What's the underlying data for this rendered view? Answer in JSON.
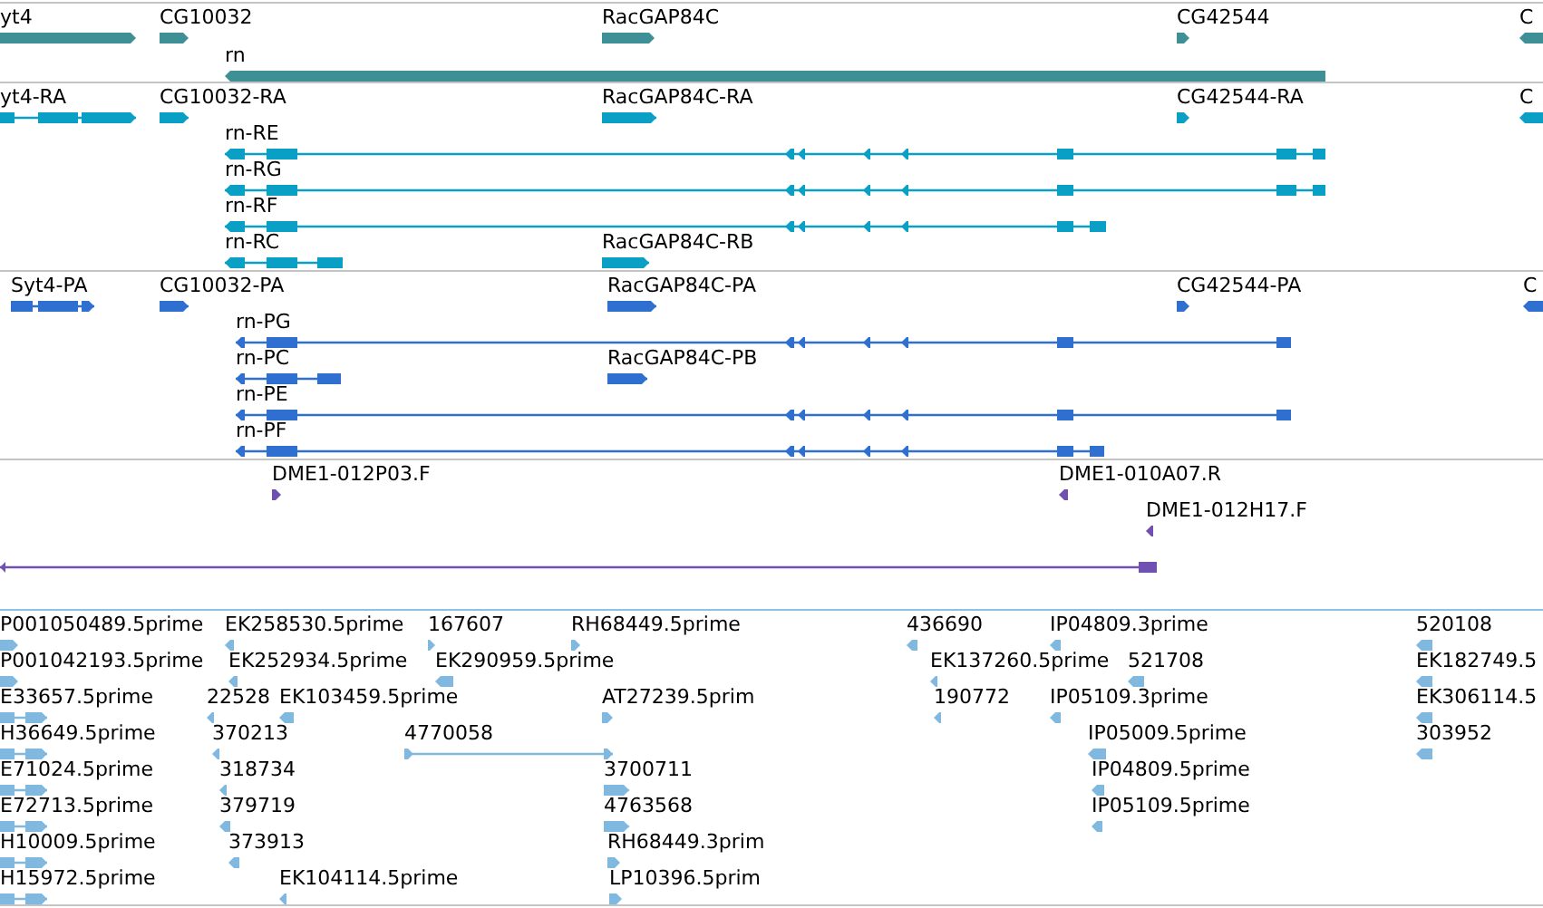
{
  "tracks": [
    {
      "color": "#3f9096",
      "features": [
        {
          "label": "yt4",
          "reverse": false
        },
        {
          "label": "CG10032",
          "reverse": false
        },
        {
          "label": "RacGAP84C",
          "reverse": false
        },
        {
          "label": "CG42544",
          "reverse": false
        },
        {
          "label": "C",
          "reverse": true
        },
        {
          "label": "rn",
          "reverse": true
        }
      ]
    },
    {
      "color": "#0a9fc4",
      "features": [
        {
          "label": "yt4-RA",
          "reverse": false
        },
        {
          "label": "CG10032-RA",
          "reverse": false
        },
        {
          "label": "RacGAP84C-RA",
          "reverse": false
        },
        {
          "label": "CG42544-RA",
          "reverse": false
        },
        {
          "label": "C",
          "reverse": true
        },
        {
          "label": "rn-RE",
          "reverse": true
        },
        {
          "label": "rn-RG",
          "reverse": true
        },
        {
          "label": "rn-RF",
          "reverse": true
        },
        {
          "label": "rn-RC",
          "reverse": true
        },
        {
          "label": "RacGAP84C-RB",
          "reverse": false
        }
      ]
    },
    {
      "color": "#2f6fd0",
      "features": [
        {
          "label": "Syt4-PA",
          "reverse": false
        },
        {
          "label": "CG10032-PA",
          "reverse": false
        },
        {
          "label": "RacGAP84C-PA",
          "reverse": false
        },
        {
          "label": "CG42544-PA",
          "reverse": false
        },
        {
          "label": "C",
          "reverse": true
        },
        {
          "label": "rn-PG",
          "reverse": true
        },
        {
          "label": "rn-PC",
          "reverse": true
        },
        {
          "label": "RacGAP84C-PB",
          "reverse": false
        },
        {
          "label": "rn-PE",
          "reverse": true
        },
        {
          "label": "rn-PF",
          "reverse": true
        }
      ]
    },
    {
      "color": "#7050b0",
      "features": [
        {
          "label": "DME1-012P03.F",
          "reverse": false
        },
        {
          "label": "DME1-010A07.R",
          "reverse": true
        },
        {
          "label": "DME1-012H17.F",
          "reverse": true
        },
        {
          "reverse": true
        }
      ]
    },
    {
      "color": "#80b8e0",
      "features": [
        {
          "label": "P001050489.5prime",
          "reverse": false
        },
        {
          "label": "EK258530.5prime",
          "reverse": true
        },
        {
          "label": "167607",
          "reverse": false
        },
        {
          "label": "RH68449.5prime",
          "reverse": false
        },
        {
          "label": "436690",
          "reverse": true
        },
        {
          "label": "IP04809.3prime",
          "reverse": true
        },
        {
          "label": "520108",
          "reverse": true
        },
        {
          "label": "P001042193.5prime",
          "reverse": false
        },
        {
          "label": "EK252934.5prime",
          "reverse": true
        },
        {
          "label": "EK290959.5prime",
          "reverse": true
        },
        {
          "label": "EK137260.5prime",
          "reverse": true
        },
        {
          "label": "521708",
          "reverse": true
        },
        {
          "label": "EK182749.5",
          "reverse": true
        },
        {
          "label": "E33657.5prime",
          "reverse": false
        },
        {
          "label": "22528",
          "reverse": true
        },
        {
          "label": "EK103459.5prime",
          "reverse": true
        },
        {
          "label": "AT27239.5prim",
          "reverse": false
        },
        {
          "label": "190772",
          "reverse": true
        },
        {
          "label": "IP05109.3prime",
          "reverse": true
        },
        {
          "label": "EK306114.5",
          "reverse": true
        },
        {
          "label": "H36649.5prime",
          "reverse": false
        },
        {
          "label": "370213",
          "reverse": true
        },
        {
          "label": "4770058",
          "reverse": false
        },
        {
          "label": "IP05009.5prime",
          "reverse": true
        },
        {
          "label": "303952",
          "reverse": true
        },
        {
          "label": "E71024.5prime",
          "reverse": false
        },
        {
          "label": "318734",
          "reverse": true
        },
        {
          "label": "3700711",
          "reverse": false
        },
        {
          "label": "IP04809.5prime",
          "reverse": true
        },
        {
          "label": "E72713.5prime",
          "reverse": false
        },
        {
          "label": "379719",
          "reverse": true
        },
        {
          "label": "4763568",
          "reverse": false
        },
        {
          "label": "IP05109.5prime",
          "reverse": true
        },
        {
          "label": "H10009.5prime",
          "reverse": false
        },
        {
          "label": "373913",
          "reverse": true
        },
        {
          "label": "RH68449.3prim",
          "reverse": false
        },
        {
          "label": "H15972.5prime",
          "reverse": false
        },
        {
          "label": "EK104114.5prime",
          "reverse": true
        },
        {
          "label": "LP10396.5prim",
          "reverse": false
        }
      ]
    }
  ]
}
